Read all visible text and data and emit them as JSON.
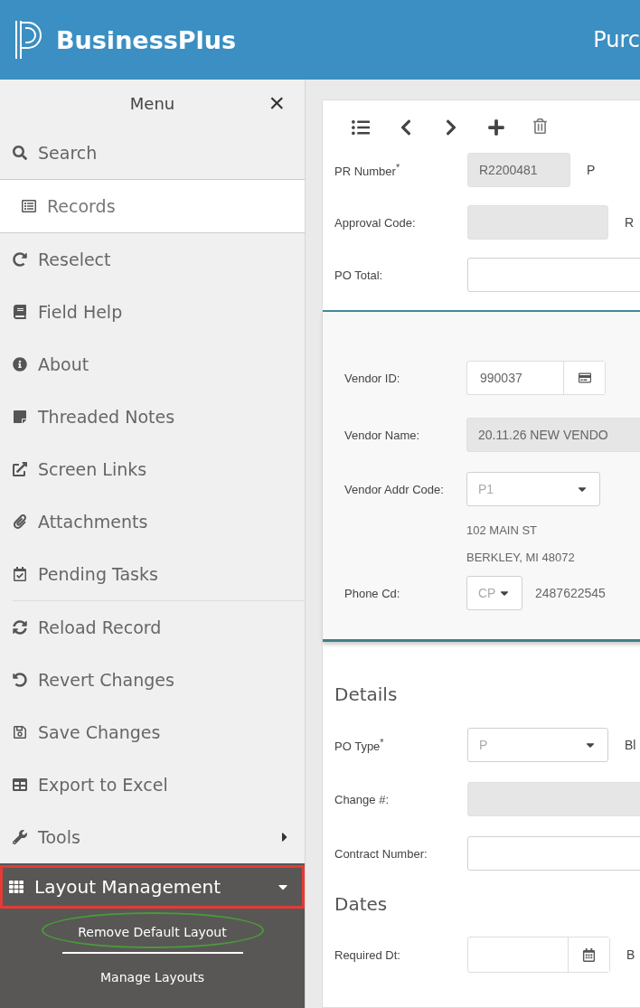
{
  "header": {
    "logo_text": "BusinessPlus",
    "page_title": "Purc"
  },
  "menu": {
    "title": "Menu",
    "close": "×",
    "items": [
      {
        "label": "Search",
        "kind": "item",
        "selected": false
      },
      {
        "label": "Records",
        "kind": "item",
        "selected": true
      },
      {
        "label": "Reselect",
        "kind": "item",
        "selected": false
      },
      {
        "label": "Field Help",
        "kind": "item",
        "selected": false
      },
      {
        "label": "About",
        "kind": "item",
        "selected": false
      },
      {
        "label": "Threaded Notes",
        "kind": "item",
        "selected": false
      },
      {
        "label": "Screen Links",
        "kind": "item",
        "selected": false
      },
      {
        "label": "Attachments",
        "kind": "item",
        "selected": false
      },
      {
        "label": "Pending Tasks",
        "kind": "item",
        "selected": false
      },
      {
        "kind": "divider"
      },
      {
        "label": "Reload Record",
        "kind": "item",
        "selected": false
      },
      {
        "label": "Revert Changes",
        "kind": "item",
        "selected": false
      },
      {
        "label": "Save Changes",
        "kind": "item",
        "selected": false
      },
      {
        "label": "Export to Excel",
        "kind": "item",
        "selected": false
      },
      {
        "label": "Tools",
        "kind": "submenu",
        "selected": false
      },
      {
        "label": "Layout Management",
        "kind": "group",
        "expanded": true,
        "highlighted": true,
        "children": [
          {
            "label": "Remove Default Layout",
            "circled": true
          },
          {
            "label": "Manage Layouts",
            "circled": false
          }
        ]
      }
    ]
  },
  "form": {
    "top_rows": [
      {
        "label": "PR Number$^{*}$",
        "kind": "text",
        "value": "R2200481",
        "disabled": true,
        "side_label": "P"
      },
      {
        "label": "Approval Code:",
        "kind": "text",
        "value": "",
        "disabled": true,
        "side_label": "R"
      },
      {
        "label": "PO Total:",
        "kind": "text",
        "value": "",
        "disabled": false
      }
    ],
    "vendor_rows": [
      {
        "label": "Vendor ID:",
        "kind": "lookup",
        "value": "990037"
      },
      {
        "label": "Vendor Name:",
        "kind": "text",
        "value": "20.11.26 NEW VENDO",
        "disabled": true
      },
      {
        "label": "Vendor Addr Code:",
        "kind": "select",
        "value": "P1"
      },
      {
        "kind": "address",
        "lines": [
          "102 MAIN ST",
          "BERKLEY, MI 48072"
        ]
      },
      {
        "label": "Phone Cd:",
        "kind": "phone",
        "value": "CP",
        "number": "2487622545"
      }
    ],
    "sections": [
      {
        "title": "Details",
        "rows": [
          {
            "label": "PO Type$^{*}$",
            "kind": "select",
            "value": "P",
            "side_label": "Bl"
          },
          {
            "label": "Change #:",
            "kind": "text",
            "value": "",
            "disabled": true
          },
          {
            "label": "Contract Number:",
            "kind": "text",
            "value": "",
            "disabled": false
          }
        ]
      },
      {
        "title": "Dates",
        "rows": [
          {
            "label": "Required Dt:",
            "kind": "date",
            "value": "",
            "side_label": "B"
          }
        ]
      }
    ]
  }
}
